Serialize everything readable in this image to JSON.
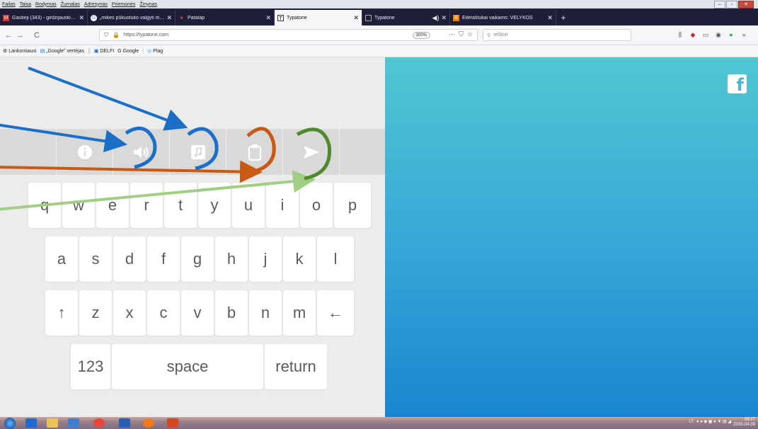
{
  "menu": [
    "Failas",
    "Taisa",
    "Rodymas",
    "Žurnalas",
    "Adresynas",
    "Priemonės",
    "Žinynas"
  ],
  "window_controls": {
    "minimize": "–",
    "maximize": "▫",
    "close": "✕"
  },
  "tabs": [
    {
      "title": "Gautieji (343) - girdzijauskiene@",
      "icon": "gmail-icon"
    },
    {
      "title": "„mikės pūkuotuko valgyti medų",
      "icon": "google-icon"
    },
    {
      "title": "Patatap",
      "icon": "patatap-icon"
    },
    {
      "title": "Typatone",
      "icon": "typatone-icon",
      "active": true
    },
    {
      "title": "Typatone",
      "icon": "typatone-icon",
      "audio": true
    },
    {
      "title": "Eilėraštukai vaikams: VELYKOS",
      "icon": "blogger-icon"
    }
  ],
  "tab_close": "✕",
  "new_tab": "+",
  "nav": {
    "back": "←",
    "forward": "→",
    "reload": "C"
  },
  "url": "https://typatone.com",
  "zoom": "300%",
  "url_actions": [
    "···",
    "⛉",
    "☆"
  ],
  "search_placeholder": "Ieškoti",
  "bookmarks": [
    {
      "label": "Lankomiausi",
      "icon": "gear"
    },
    {
      "label": "„Google\" vertėjas",
      "icon": "translate"
    },
    {
      "label": "DELFI",
      "icon": "delfi"
    },
    {
      "label": "Google",
      "icon": "google"
    },
    {
      "label": "Plag",
      "icon": "plag"
    }
  ],
  "keyboard": {
    "row1": [
      "q",
      "w",
      "e",
      "r",
      "t",
      "y",
      "u",
      "i",
      "o",
      "p"
    ],
    "row2": [
      "a",
      "s",
      "d",
      "f",
      "g",
      "h",
      "j",
      "k",
      "l"
    ],
    "row3": [
      "↑",
      "z",
      "x",
      "c",
      "v",
      "b",
      "n",
      "m",
      "←"
    ],
    "row4": [
      "123",
      "space",
      "return"
    ]
  },
  "toolbar_tools": [
    "info-icon",
    "speaker-icon",
    "music-note-icon",
    "clipboard-icon",
    "send-icon"
  ],
  "facebook_label": "f",
  "colors": {
    "annotation_blue": "#1b6fc6",
    "annotation_orange": "#c85a14",
    "annotation_green": "#4f8a2e",
    "annotation_light_green": "#9fce84",
    "tool_strip": "#d9d9d9"
  },
  "taskbar": {
    "apps": [
      "start-orb",
      "outlook-icon",
      "explorer-icon",
      "window-icon",
      "chrome-icon",
      "word-icon",
      "firefox-icon",
      "powerpoint-icon"
    ],
    "lang": "LT",
    "clock_time": "09:27",
    "clock_date": "2020-04-09"
  }
}
